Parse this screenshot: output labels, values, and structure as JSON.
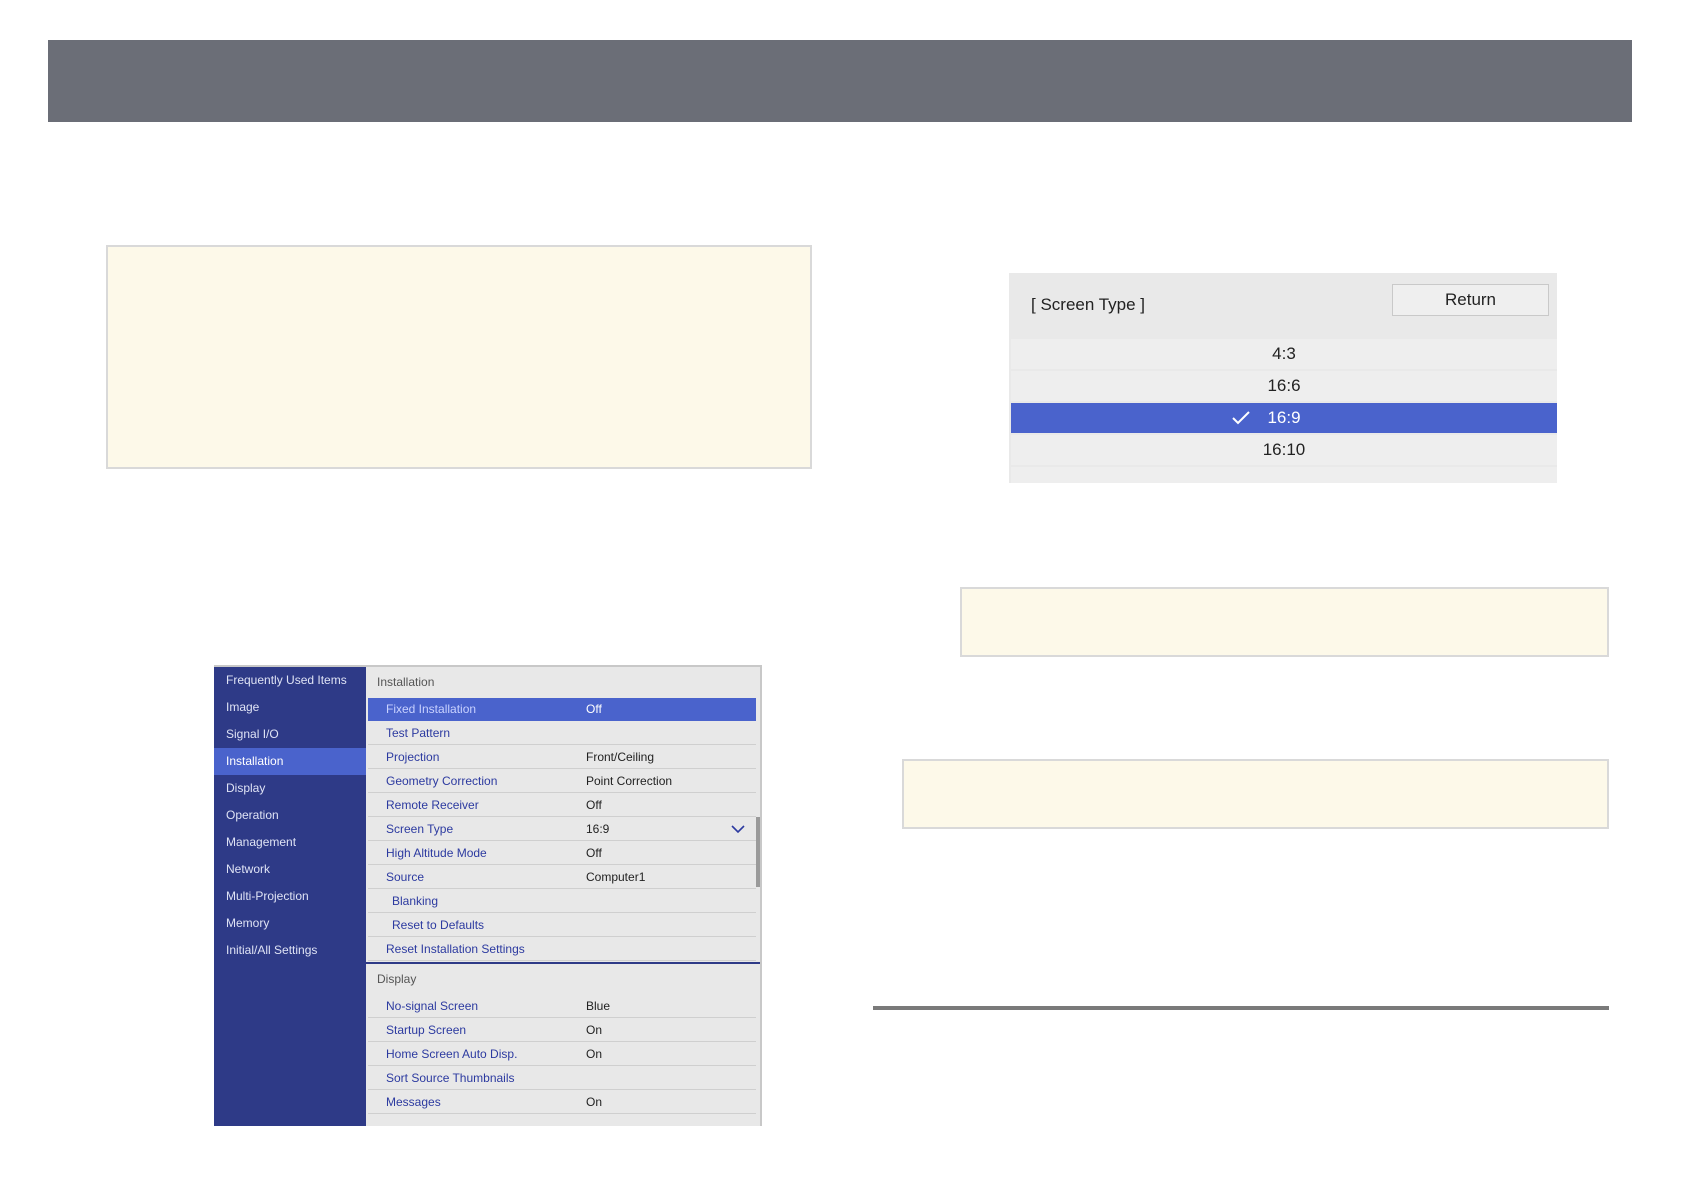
{
  "notes": [
    "",
    "",
    ""
  ],
  "menu": {
    "sidebar": [
      "Frequently Used Items",
      "Image",
      "Signal I/O",
      "Installation",
      "Display",
      "Operation",
      "Management",
      "Network",
      "Multi-Projection",
      "Memory",
      "Initial/All Settings"
    ],
    "active_sidebar_item": "Installation",
    "section_installation": "Installation",
    "installation_rows": [
      {
        "label": "Fixed Installation",
        "value": "Off"
      },
      {
        "label": "Test Pattern",
        "value": ""
      },
      {
        "label": "Projection",
        "value": "Front/Ceiling"
      },
      {
        "label": "Geometry Correction",
        "value": "Point Correction"
      },
      {
        "label": "Remote Receiver",
        "value": "Off"
      },
      {
        "label": "Screen Type",
        "value": "16:9"
      },
      {
        "label": "High Altitude Mode",
        "value": "Off"
      },
      {
        "label": "Source",
        "value": "Computer1"
      },
      {
        "label": "Blanking",
        "value": ""
      },
      {
        "label": "Reset to Defaults",
        "value": ""
      },
      {
        "label": "Reset Installation Settings",
        "value": ""
      }
    ],
    "section_display": "Display",
    "display_rows": [
      {
        "label": "No-signal Screen",
        "value": "Blue"
      },
      {
        "label": "Startup Screen",
        "value": "On"
      },
      {
        "label": "Home Screen Auto Disp.",
        "value": "On"
      },
      {
        "label": "Sort Source Thumbnails",
        "value": ""
      },
      {
        "label": "Messages",
        "value": "On"
      }
    ]
  },
  "screen_type_dialog": {
    "title": "[ Screen Type ]",
    "return_label": "Return",
    "options": [
      "4:3",
      "16:6",
      "16:9",
      "16:10"
    ],
    "selected": "16:9"
  },
  "colors": {
    "header": "#6b6e77",
    "note_background": "#fdf9e9",
    "menu_sidebar": "#2e3a87",
    "menu_selected": "#4a63cc"
  }
}
